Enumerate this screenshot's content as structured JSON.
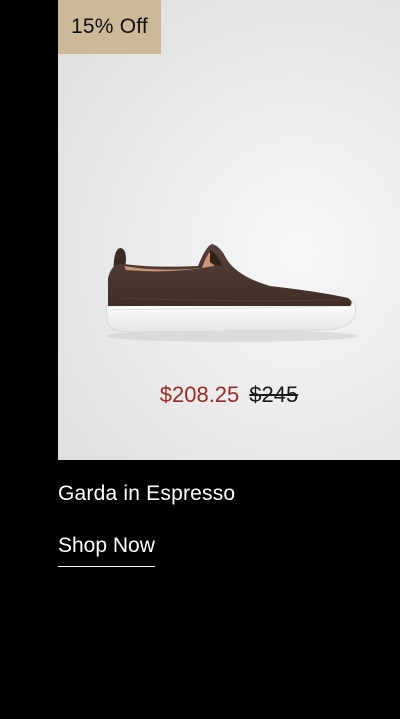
{
  "product_card": {
    "badge": "15% Off",
    "sale_price": "$208.25",
    "original_price": "$245",
    "name": "Garda in Espresso",
    "cta_label": "Shop Now",
    "image_icon": "slip-on-sneaker",
    "colors": {
      "badge_bg": "#cbb99a",
      "sale_price": "#9a2a24",
      "page_bg": "#000000",
      "shoe_upper": "#4a362c",
      "sole": "#ffffff"
    }
  }
}
